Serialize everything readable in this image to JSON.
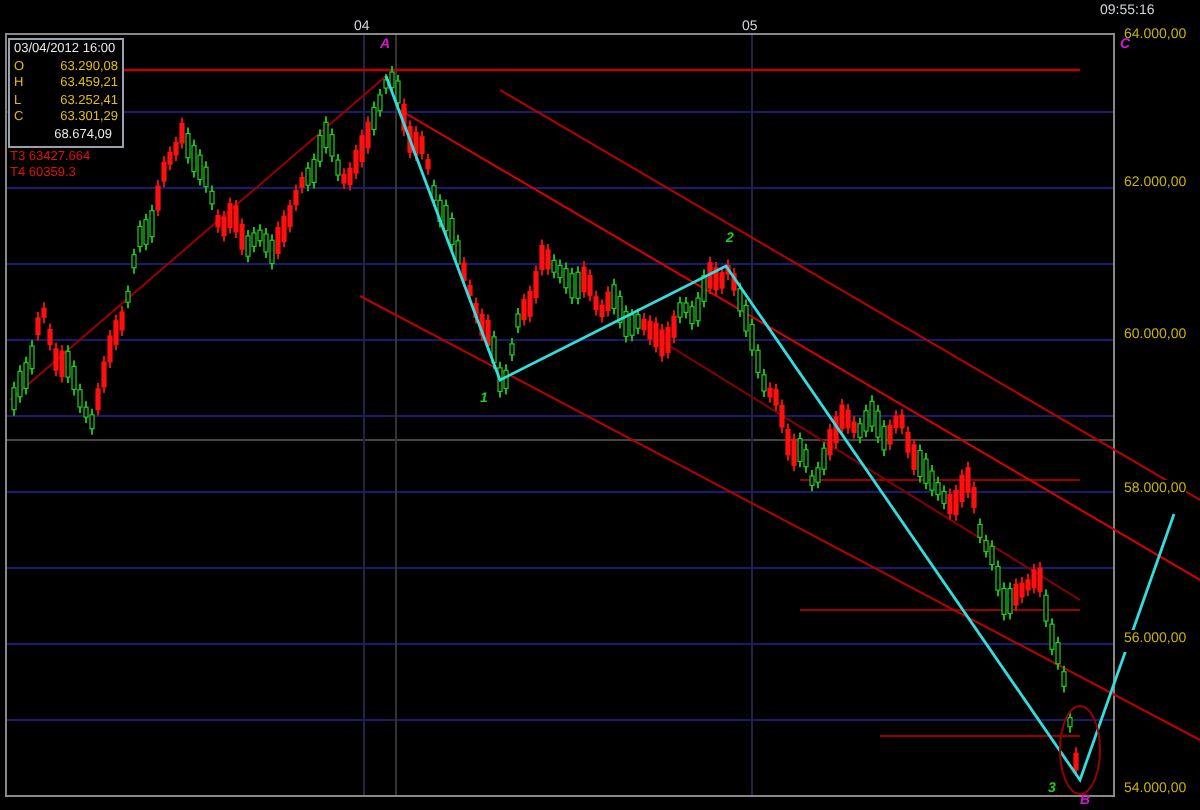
{
  "clock": "09:55:16",
  "time_axis": {
    "labels": [
      "04",
      "05"
    ]
  },
  "price_axis": {
    "labels": [
      "64.000,00",
      "62.000,00",
      "60.000,00",
      "58.000,00",
      "56.000,00",
      "54.000,00"
    ]
  },
  "info_box": {
    "date": "03/04/2012 16:00",
    "rows": [
      {
        "label": "O",
        "value": "63.290,08"
      },
      {
        "label": "H",
        "value": "63.459,21"
      },
      {
        "label": "L",
        "value": "63.252,41"
      },
      {
        "label": "C",
        "value": "63.301,29"
      }
    ],
    "cursor_value": "68.674,09"
  },
  "targets": [
    "T3 63427.664",
    "T4 60359.3"
  ],
  "wave_labels": [
    {
      "text": "A",
      "kind": "corrective"
    },
    {
      "text": "1",
      "kind": "impulse"
    },
    {
      "text": "2",
      "kind": "impulse"
    },
    {
      "text": "C",
      "kind": "corrective"
    },
    {
      "text": "3",
      "kind": "impulse"
    },
    {
      "text": "B",
      "kind": "corrective"
    }
  ]
}
